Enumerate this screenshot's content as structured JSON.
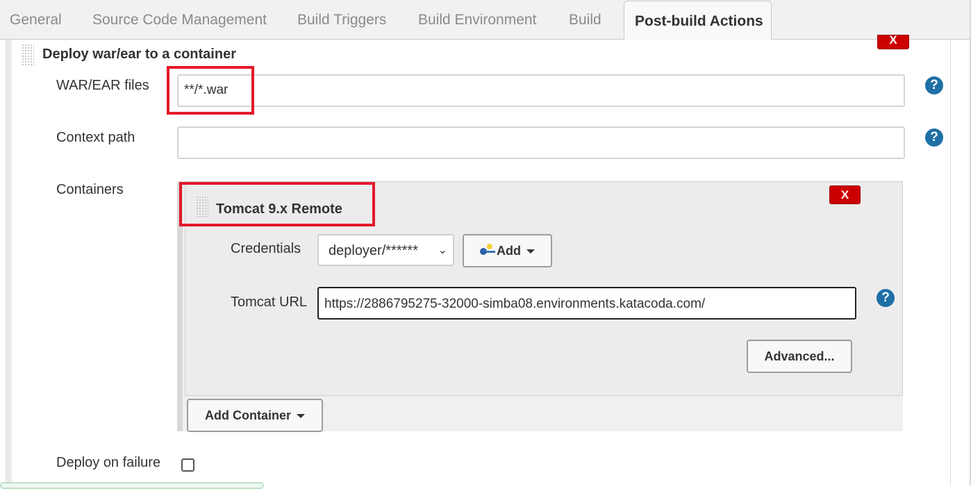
{
  "tabs": [
    {
      "label": "General"
    },
    {
      "label": "Source Code Management"
    },
    {
      "label": "Build Triggers"
    },
    {
      "label": "Build Environment"
    },
    {
      "label": "Build"
    },
    {
      "label": "Post-build Actions"
    }
  ],
  "deploy_section": {
    "title": "Deploy war/ear to a container",
    "delete_label": "X",
    "war_files": {
      "label": "WAR/EAR files",
      "value": "**/*.war"
    },
    "context_path": {
      "label": "Context path",
      "value": ""
    },
    "containers_label": "Containers",
    "deploy_on_failure_label": "Deploy on failure",
    "deploy_on_failure_checked": false,
    "help_glyph": "?"
  },
  "container": {
    "title": "Tomcat 9.x Remote",
    "delete_label": "X",
    "credentials": {
      "label": "Credentials",
      "selected": "deployer/******",
      "add_label": "Add"
    },
    "tomcat_url": {
      "label": "Tomcat URL",
      "value": "https://2886795275-32000-simba08.environments.katacoda.com/"
    },
    "advanced_label": "Advanced...",
    "add_container_label": "Add Container"
  },
  "colors": {
    "highlight": "#e3192b",
    "delete_button": "#cc0000",
    "help_icon": "#1d6fa5"
  }
}
